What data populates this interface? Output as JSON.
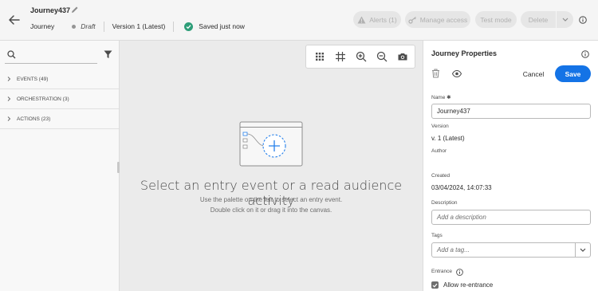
{
  "header": {
    "journey_name": "Journey437",
    "type_label": "Journey",
    "status": "Draft",
    "version": "Version 1 (Latest)",
    "save_status": "Saved just now",
    "alerts_label": "Alerts (1)",
    "manage_access_label": "Manage access",
    "test_mode_label": "Test mode",
    "delete_label": "Delete"
  },
  "palette": {
    "search_placeholder": "",
    "categories": [
      {
        "label": "EVENTS (49)"
      },
      {
        "label": "ORCHESTRATION (3)"
      },
      {
        "label": "ACTIONS (23)"
      }
    ]
  },
  "canvas": {
    "title": "Select an entry event or a read audience activity",
    "line1": "Use the palette on the left to select an entry event.",
    "line2": "Double click on it or drag it into the canvas.",
    "tools": [
      "grid-icon",
      "fit-icon",
      "zoom-in-icon",
      "zoom-out-icon",
      "camera-icon"
    ]
  },
  "panel": {
    "title": "Journey Properties",
    "cancel_label": "Cancel",
    "save_label": "Save",
    "name_label": "Name",
    "name_value": "Journey437",
    "version_label": "Version",
    "version_value": "v. 1 (Latest)",
    "author_label": "Author",
    "author_value": "",
    "created_label": "Created",
    "created_value": "03/04/2024, 14:07:33",
    "description_label": "Description",
    "description_placeholder": "Add a description",
    "tags_label": "Tags",
    "tags_placeholder": "Add a tag...",
    "entrance_label": "Entrance",
    "reentrance_label": "Allow re-entrance",
    "reentrance_checked": true
  },
  "colors": {
    "accent": "#1473e6",
    "success": "#2d9d78",
    "canvas_bg": "#ebebeb"
  }
}
